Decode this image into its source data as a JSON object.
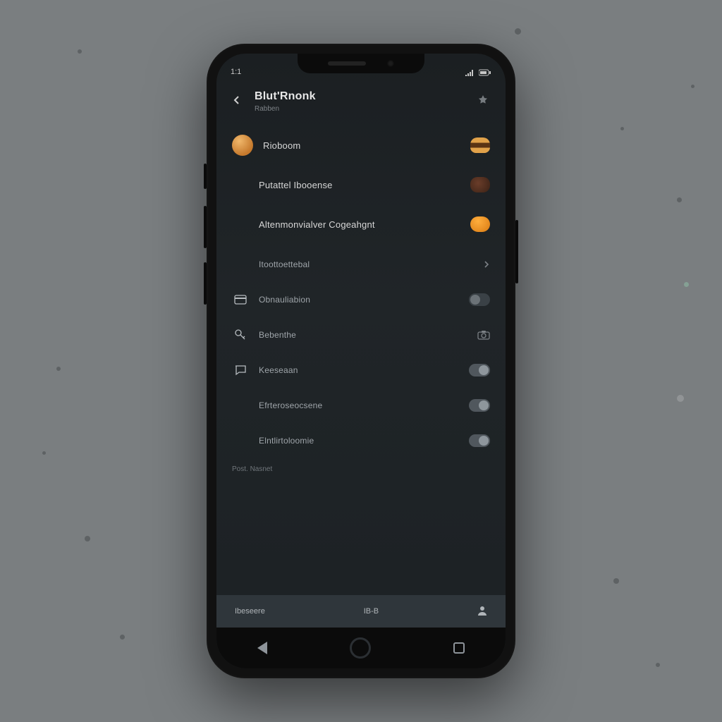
{
  "status": {
    "time": "1:1",
    "signal": "signal-icon",
    "battery": "battery-icon"
  },
  "header": {
    "title": "Blut'Rnonk",
    "subtitle": "Rabben",
    "action_icon": "star-icon"
  },
  "featured": [
    {
      "label": "Rioboom",
      "lead": "avatar",
      "trail": "burger"
    },
    {
      "label": "Putattel Ibooense",
      "trail": "meat"
    },
    {
      "label": "Altenmonvialver Cogeahgnt",
      "trail": "bun"
    }
  ],
  "menu": [
    {
      "icon": null,
      "label": "Itoottoettebal",
      "trail": "chevron"
    },
    {
      "icon": "card-icon",
      "label": "Obnauliabion",
      "trail": "toggle-off"
    },
    {
      "icon": "key-icon",
      "label": "Bebenthe",
      "trail": "camera"
    },
    {
      "icon": "chat-icon",
      "label": "Keeseaan",
      "trail": "toggle-on"
    },
    {
      "icon": null,
      "label": "Efrteroseocsene",
      "trail": "toggle-on"
    },
    {
      "icon": null,
      "label": "Elntlirtoloomie",
      "trail": "toggle-on"
    }
  ],
  "section_caption": "Post. Nasnet",
  "tabbar": {
    "left": "Ibeseere",
    "mid": "IB-B",
    "right_icon": "person-icon"
  }
}
